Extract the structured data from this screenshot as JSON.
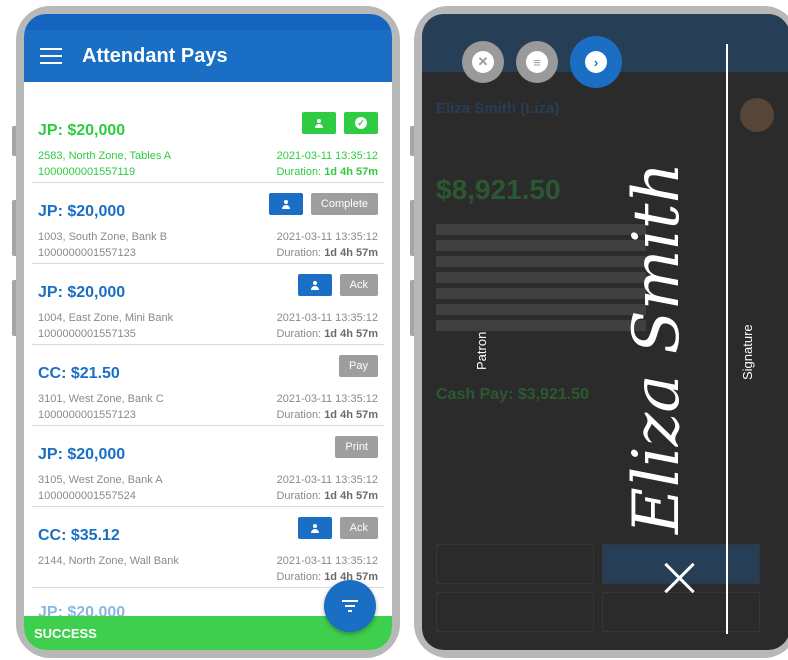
{
  "left_screen": {
    "app_title": "Attendant Pays",
    "rows": [
      {
        "amount": "JP: $20,000",
        "location": "2583, North Zone, Tables A",
        "id": "1000000001557119",
        "datetime": "2021-03-11 13:35:12",
        "duration_label": "Duration:",
        "duration": "1d 4h 57m",
        "status": "green",
        "action_label": ""
      },
      {
        "amount": "JP: $20,000",
        "location": "1003, South Zone, Bank B",
        "id": "1000000001557123",
        "datetime": "2021-03-11 13:35:12",
        "duration_label": "Duration:",
        "duration": "1d 4h 57m",
        "status": "normal",
        "action_label": "Complete"
      },
      {
        "amount": "JP: $20,000",
        "location": "1004, East Zone, Mini Bank",
        "id": "1000000001557135",
        "datetime": "2021-03-11 13:35:12",
        "duration_label": "Duration:",
        "duration": "1d 4h 57m",
        "status": "normal",
        "action_label": "Ack"
      },
      {
        "amount": "CC: $21.50",
        "location": "3101, West Zone, Bank C",
        "id": "1000000001557123",
        "datetime": "2021-03-11 13:35:12",
        "duration_label": "Duration:",
        "duration": "1d 4h 57m",
        "status": "normal",
        "action_label": "Pay"
      },
      {
        "amount": "JP: $20,000",
        "location": "3105, West Zone, Bank A",
        "id": "1000000001557524",
        "datetime": "2021-03-11 13:35:12",
        "duration_label": "Duration:",
        "duration": "1d 4h 57m",
        "status": "normal",
        "action_label": "Print"
      },
      {
        "amount": "CC: $35.12",
        "location": "2144, North Zone, Wall Bank",
        "id": "",
        "datetime": "2021-03-11 13:35:12",
        "duration_label": "Duration:",
        "duration": "1d 4h 57m",
        "status": "normal",
        "action_label": "Ack"
      }
    ],
    "partial_row_amount": "JP: $20,000",
    "snackbar_text": "SUCCESS",
    "icons": {
      "menu": "hamburger-menu-icon",
      "fab": "filter-icon",
      "person": "person-icon",
      "check": "check-circle-icon"
    }
  },
  "right_screen": {
    "dim_name": "Eliza Smith (Liza)",
    "dim_total": "$8,921.50",
    "dim_cash": "Cash Pay: $3,921.50",
    "patron_label": "Patron",
    "signature_label": "Signature",
    "signature_text": "Eliza Smith",
    "icons": {
      "clear": "close-circle-icon",
      "list": "list-icon",
      "next": "arrow-right-icon",
      "close": "close-icon"
    }
  },
  "colors": {
    "brand_blue": "#1a6fc4",
    "success_green": "#2ecc40",
    "gray_button": "#9e9e9e"
  }
}
